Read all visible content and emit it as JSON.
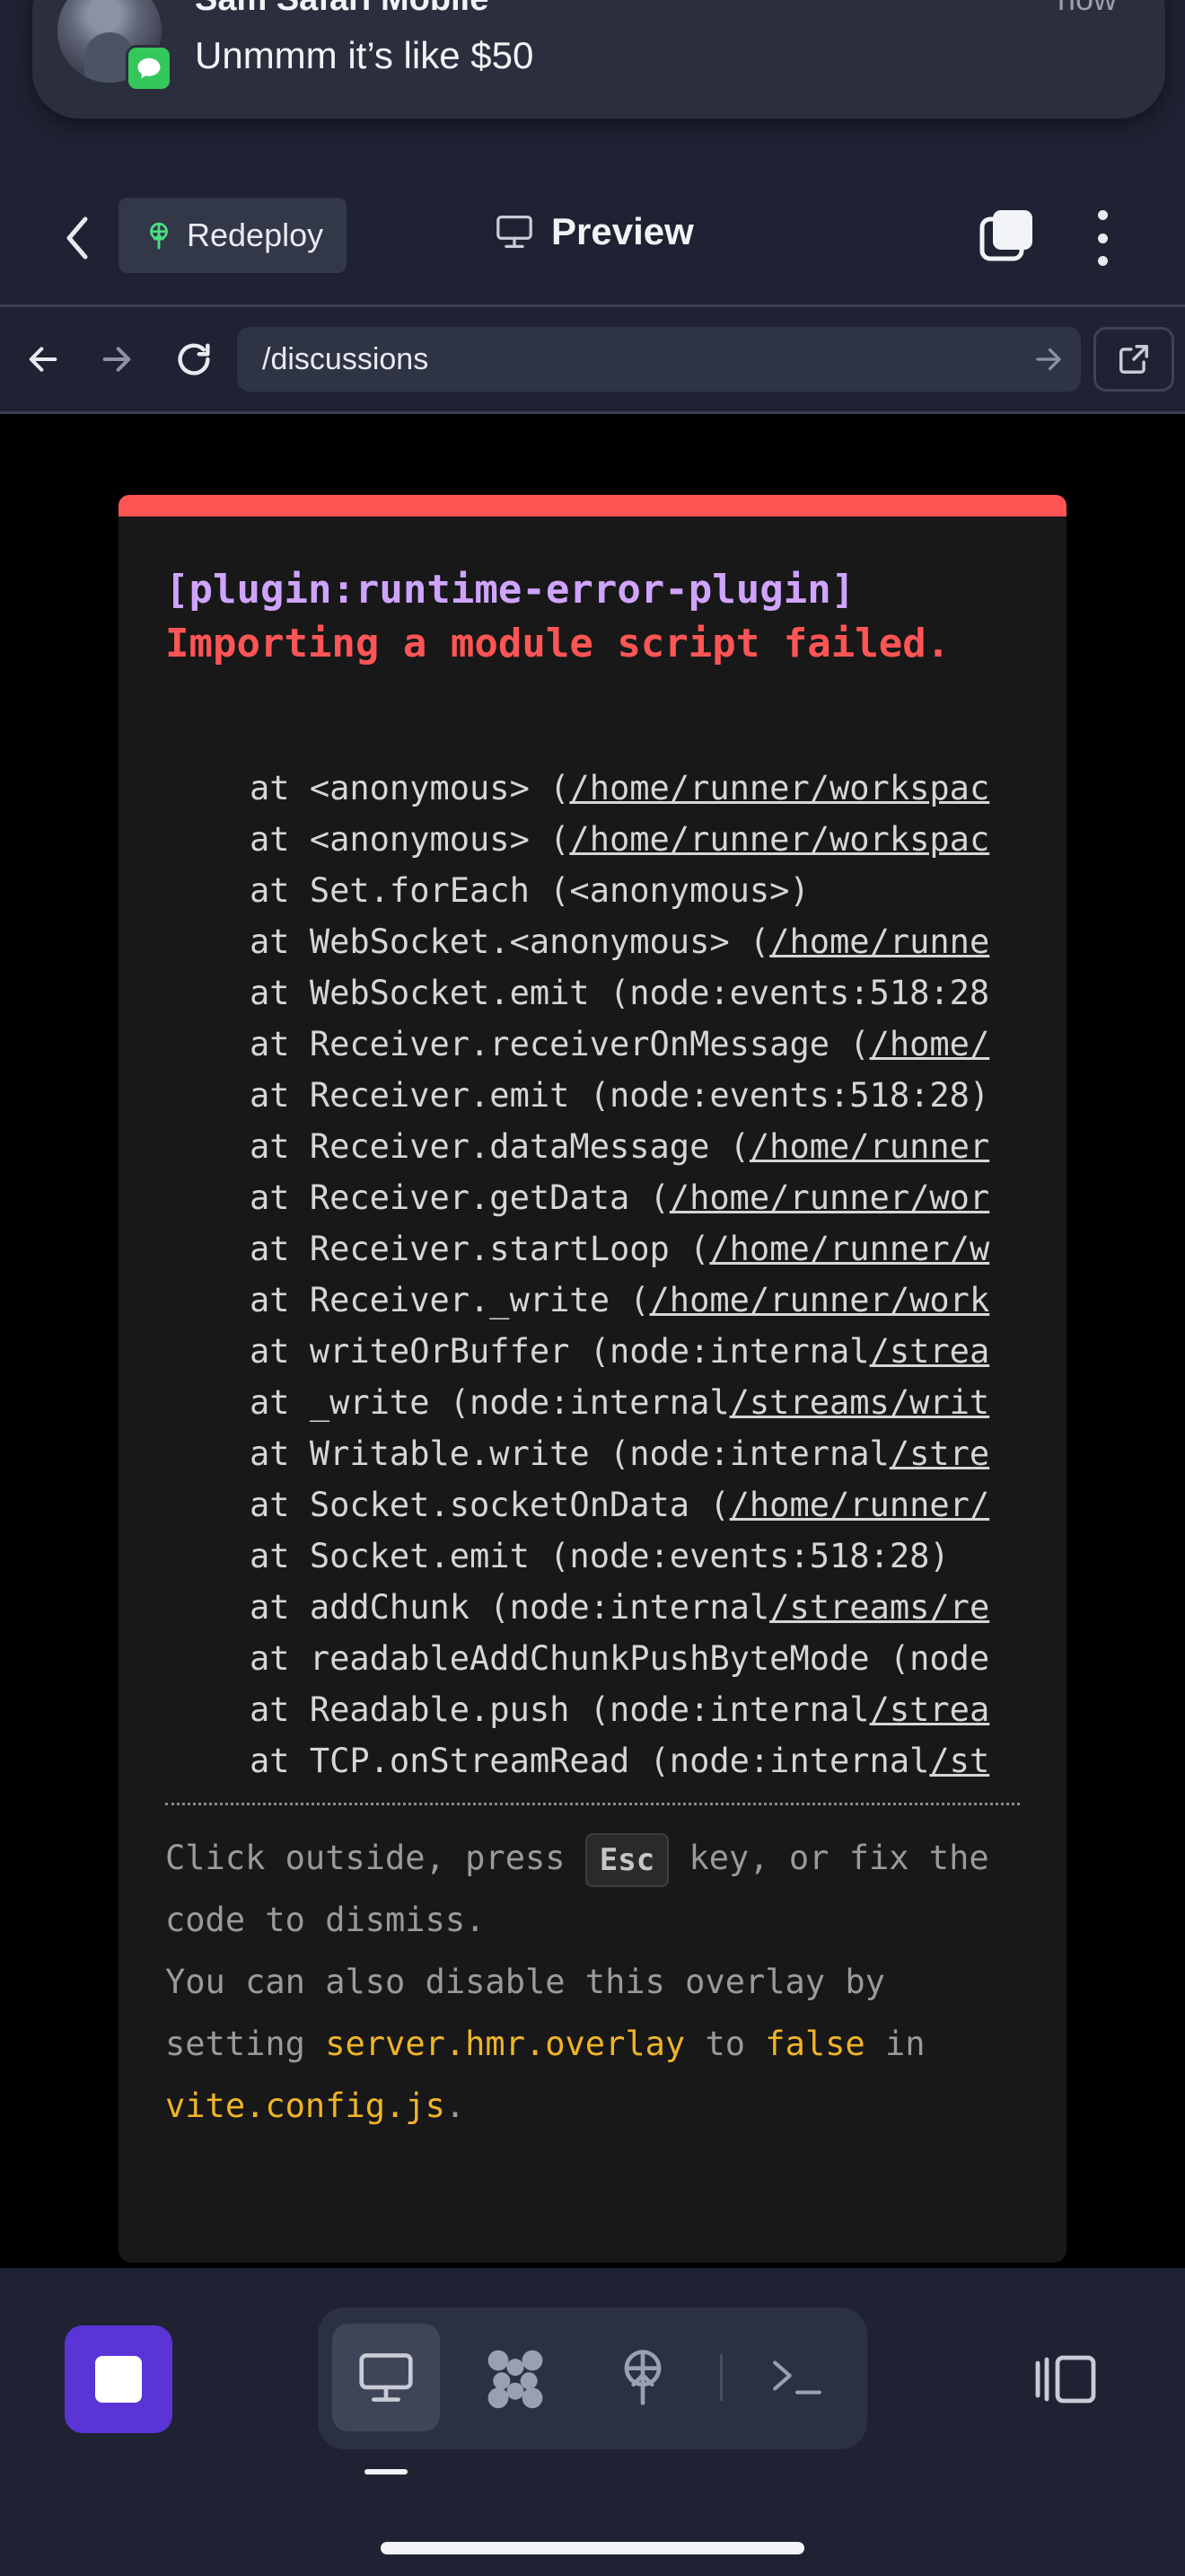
{
  "notification": {
    "sender": "Sam Safari Mobile",
    "time": "now",
    "message": "Unmmm it’s like $50",
    "app_icon": "messages-icon",
    "badge_color": "#34c759"
  },
  "header": {
    "back_icon": "chevron-left-icon",
    "redeploy_label": "Redeploy",
    "title": "Preview",
    "title_icon": "monitor-icon",
    "tabs_icon": "tabs-icon",
    "more_icon": "kebab-menu-icon"
  },
  "browser": {
    "url": "/discussions",
    "back_icon": "arrow-left-icon",
    "forward_icon": "arrow-right-icon",
    "reload_icon": "reload-icon",
    "go_icon": "arrow-right-icon",
    "open_external_icon": "external-link-icon"
  },
  "error_overlay": {
    "plugin": "[plugin:runtime-error-plugin]",
    "message": "Importing a module script failed.",
    "accent_color": "#ff5555",
    "stack": [
      "at <anonymous> (/home/runner/workspac",
      "at <anonymous> (/home/runner/workspac",
      "at Set.forEach (<anonymous>)",
      "at WebSocket.<anonymous> (/home/runne",
      "at WebSocket.emit (node:events:518:28",
      "at Receiver.receiverOnMessage (/home/",
      "at Receiver.emit (node:events:518:28)",
      "at Receiver.dataMessage (/home/runner",
      "at Receiver.getData (/home/runner/wor",
      "at Receiver.startLoop (/home/runner/w",
      "at Receiver._write (/home/runner/work",
      "at writeOrBuffer (node:internal/strea",
      "at _write (node:internal/streams/writ",
      "at Writable.write (node:internal/stre",
      "at Socket.socketOnData (/home/runner/",
      "at Socket.emit (node:events:518:28)",
      "at addChunk (node:internal/streams/re",
      "at readableAddChunkPushByteMode (node",
      "at Readable.push (node:internal/strea",
      "at TCP.onStreamRead (node:internal/st"
    ],
    "tip": {
      "part1": "Click outside, press ",
      "key": "Esc",
      "part2": " key, or fix the code to dismiss.",
      "part3": "You can also disable this overlay by setting ",
      "code1": "server.hmr.overlay",
      "part4": " to ",
      "code2": "false",
      "part5": " in ",
      "code3": "vite.config.js",
      "part6": "."
    }
  },
  "toolbar": {
    "stop_icon": "stop-icon",
    "stop_color": "#5b34d6",
    "tools": [
      {
        "icon": "monitor-icon",
        "active": true
      },
      {
        "icon": "grid-apps-icon",
        "active": false
      },
      {
        "icon": "deploy-icon",
        "active": false
      },
      {
        "icon": "terminal-icon",
        "active": false
      }
    ],
    "split_icon": "split-view-icon"
  }
}
